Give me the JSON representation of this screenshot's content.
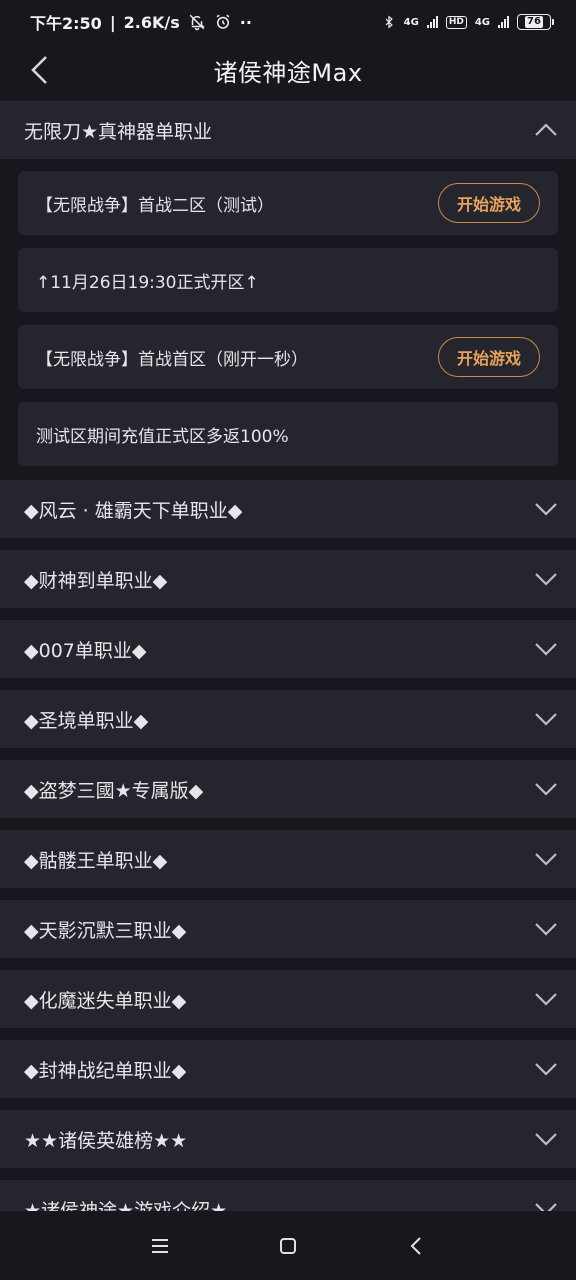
{
  "status": {
    "time": "下午2:50",
    "speed": "2.6K/s",
    "net1": "4G",
    "hd": "HD",
    "net2": "4G",
    "battery": "76"
  },
  "header": {
    "title": "诸侯神途Max"
  },
  "expanded_section": {
    "title": "无限刀★真神器单职业",
    "rows": [
      {
        "text": "【无限战争】首战二区（测试）",
        "button": "开始游戏"
      },
      {
        "text": "↑11月26日19:30正式开区↑"
      },
      {
        "text": "【无限战争】首战首区（刚开一秒）",
        "button": "开始游戏"
      },
      {
        "text": "测试区期间充值正式区多返100%"
      }
    ]
  },
  "sections": [
    "◆风云 · 雄霸天下单职业◆",
    "◆财神到单职业◆",
    "◆007单职业◆",
    "◆圣境单职业◆",
    "◆盗梦三國★专属版◆",
    "◆骷髅王单职业◆",
    "◆天影沉默三职业◆",
    "◆化魔迷失单职业◆",
    "◆封神战纪单职业◆",
    "★★诸侯英雄榜★★",
    "★诸侯神途★游戏介绍★"
  ],
  "colors": {
    "accent": "#e8a25d",
    "card": "#24252d",
    "bg": "#17181d"
  }
}
